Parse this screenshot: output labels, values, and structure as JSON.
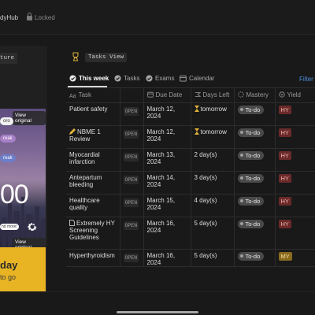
{
  "header": {
    "title": "dyHub",
    "locked_label": "Locked"
  },
  "left_panel": {
    "pill_text": "ture",
    "widget": {
      "view_original_1": "View original",
      "chip_1": "oro",
      "chip_2": "reak",
      "chip_3": "reak",
      "time": "00",
      "control_text": "nd more!",
      "view_original_2": "View original",
      "footer_title": "day",
      "footer_sub": "to go"
    }
  },
  "tasks_view": {
    "title": "Tasks View",
    "tabs": [
      {
        "label": "This week",
        "active": true
      },
      {
        "label": "Tasks",
        "active": false
      },
      {
        "label": "Exams",
        "active": false
      },
      {
        "label": "Calendar",
        "active": false
      }
    ],
    "filter_label": "Filter",
    "columns": {
      "task": "Task",
      "due": "Due Date",
      "days": "Days Left",
      "mastery": "Mastery",
      "yield": "Yield"
    },
    "rows": [
      {
        "task": "Patient safety",
        "open": "OPEN",
        "due": "March 12, 2024",
        "days": "tomorrow",
        "mastery": "To-do",
        "yield": "HY"
      },
      {
        "task": "NBME 1 Review",
        "open": "OPEN",
        "due": "March 12, 2024",
        "days": "tomorrow",
        "mastery": "To-do",
        "yield": "HY"
      },
      {
        "task": "Myocardial infarction",
        "open": "OPEN",
        "due": "March 13, 2024",
        "days": "2 day(s)",
        "mastery": "To-do",
        "yield": "HY"
      },
      {
        "task": "Antepartum bleeding",
        "open": "OPEN",
        "due": "March 14, 2024",
        "days": "3 day(s)",
        "mastery": "To-do",
        "yield": "HY"
      },
      {
        "task": "Healthcare quality",
        "open": "OPEN",
        "due": "March 15, 2024",
        "days": "4 day(s)",
        "mastery": "To-do",
        "yield": "HY"
      },
      {
        "task": "Extremely HY Screening Guidelines",
        "open": "OPEN",
        "due": "March 16, 2024",
        "days": "5 day(s)",
        "mastery": "To-do",
        "yield": "HY"
      },
      {
        "task": "Hyperthyroidism",
        "open": "OPEN",
        "due": "March 16, 2024",
        "days": "5 day(s)",
        "mastery": "To-do",
        "yield": "MY"
      }
    ]
  },
  "colors": {
    "background": "#191919",
    "accent": "#4a8fe0",
    "hy_tag": "#6b2a2a",
    "my_tag": "#8a6a1e",
    "widget_footer": "#e8b423"
  }
}
